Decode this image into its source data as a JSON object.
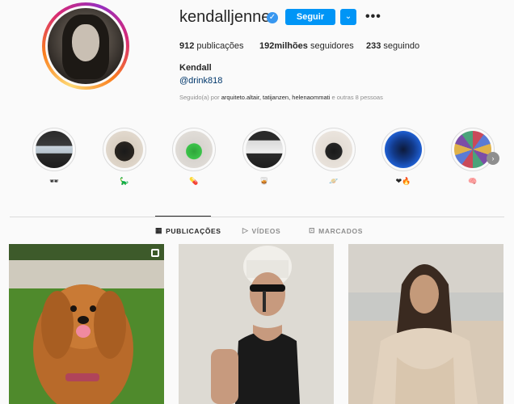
{
  "profile": {
    "username": "kendalljenner",
    "verified_glyph": "✓",
    "follow_label": "Seguir",
    "dropdown_glyph": "⌄",
    "more_glyph": "•••",
    "stats": {
      "posts_count": "912",
      "posts_label": "publicações",
      "followers_count": "192milhões",
      "followers_label": "seguidores",
      "following_count": "233",
      "following_label": "seguindo"
    },
    "full_name": "Kendall",
    "bio_handle": "@drink818",
    "followed_by_prefix": "Seguido(a) por",
    "followed_by_names": "arquiteto.altair, tatijanzen, helenaommati",
    "followed_by_suffix": "e outras 8 pessoas"
  },
  "highlights": [
    {
      "label": "🕶",
      "icon": "sunglasses-icon"
    },
    {
      "label": "🦕",
      "icon": "sauropod-icon"
    },
    {
      "label": "💊",
      "icon": "pill-icon"
    },
    {
      "label": "🥃",
      "icon": "tumbler-glass-icon"
    },
    {
      "label": "🪐",
      "icon": "ringed-planet-icon"
    },
    {
      "label": "❤🔥",
      "icon": "heart-fire-icon"
    },
    {
      "label": "🧠",
      "icon": "brain-icon"
    }
  ],
  "highlights_next_glyph": "›",
  "tabs": [
    {
      "label": "PUBLICAÇÕES",
      "icon": "grid-icon",
      "active": true
    },
    {
      "label": "VÍDEOS",
      "icon": "play-icon",
      "active": false
    },
    {
      "label": "MARCADOS",
      "icon": "tagged-icon",
      "active": false
    }
  ],
  "colors": {
    "accent": "#0095f6",
    "verified": "#3897f0",
    "background": "#fafafa",
    "divider": "#dbdbdb",
    "muted_text": "#8e8e8e"
  }
}
